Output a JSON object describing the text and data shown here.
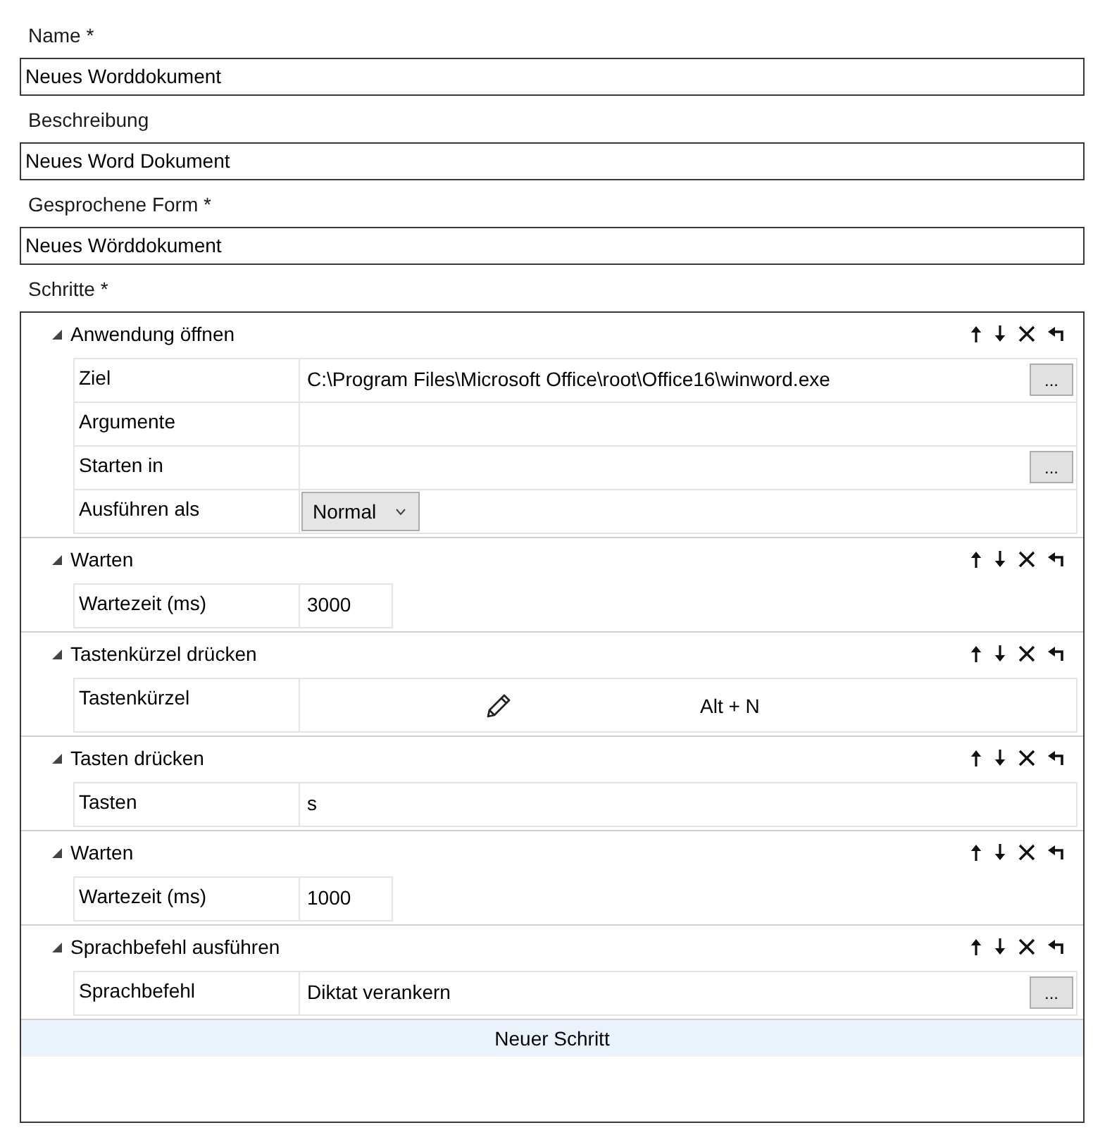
{
  "form_fields": [
    {
      "label": "Name *",
      "value": "Neues Worddokument"
    },
    {
      "label": "Beschreibung",
      "value": "Neues Word Dokument"
    },
    {
      "label": "Gesprochene Form *",
      "value": "Neues Wörddokument"
    }
  ],
  "steps_label": "Schritte *",
  "steps": [
    {
      "title": "Anwendung öffnen",
      "expanded": true,
      "properties": [
        {
          "kind": "path",
          "label": "Ziel",
          "value": "C:\\Program Files\\Microsoft Office\\root\\Office16\\winword.exe",
          "browse_button": "..."
        },
        {
          "kind": "text",
          "label": "Argumente"
        },
        {
          "kind": "path",
          "label": "Starten in",
          "browse_button": "..."
        },
        {
          "kind": "dropdown",
          "label": "Ausführen als",
          "value": "Normal"
        }
      ]
    },
    {
      "title": "Warten",
      "expanded": true,
      "properties": [
        {
          "kind": "number",
          "label": "Wartezeit (ms)",
          "value": "3000"
        }
      ]
    },
    {
      "title": "Tastenkürzel drücken",
      "expanded": true,
      "properties": [
        {
          "kind": "shortcut",
          "label": "Tastenkürzel",
          "value": "Alt + N"
        }
      ]
    },
    {
      "title": "Tasten drücken",
      "expanded": true,
      "properties": [
        {
          "kind": "text",
          "label": "Tasten",
          "value": "s"
        }
      ]
    },
    {
      "title": "Warten",
      "expanded": true,
      "properties": [
        {
          "kind": "number",
          "label": "Wartezeit (ms)",
          "value": "1000"
        }
      ]
    },
    {
      "title": "Sprachbefehl ausführen",
      "expanded": true,
      "properties": [
        {
          "kind": "path",
          "label": "Sprachbefehl",
          "value": "Diktat verankern",
          "browse_button": "..."
        }
      ]
    }
  ],
  "new_step_button": "Neuer Schritt"
}
